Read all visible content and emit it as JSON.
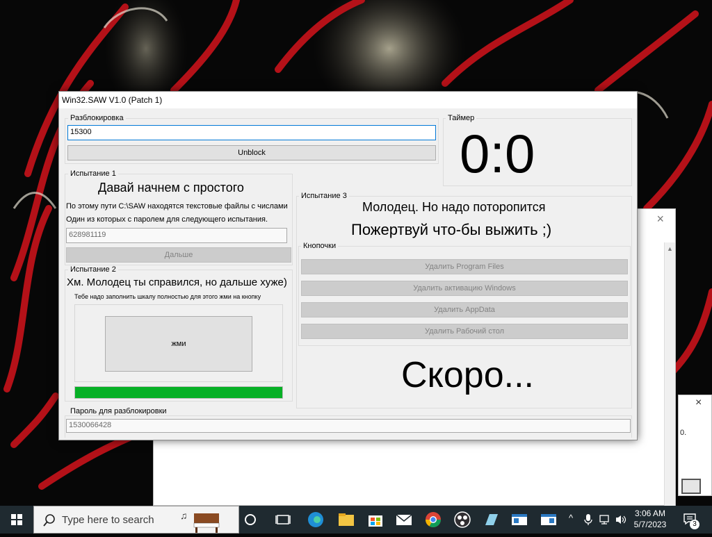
{
  "app": {
    "title": "Win32.SAW V1.0 (Patch 1)",
    "unlock": {
      "group_label": "Разблокировка",
      "input_value": "15300",
      "button_label": "Unblock"
    },
    "timer": {
      "group_label": "Таймер",
      "value": "0:0"
    },
    "test1": {
      "group_label": "Испытание 1",
      "heading": "Давай начнем с простого",
      "line1": "По этому пути C:\\SAW находятся текстовые файлы с числами",
      "line2": "Один из которых с паролем для следующего испытания.",
      "input_value": "628981119",
      "next_label": "Дальше"
    },
    "test2": {
      "group_label": "Испытание 2",
      "heading": "Хм. Молодец ты справился, но дальше хуже)",
      "instruction": "Тебе надо заполнить шкалу полностью для этого жми на кнопку",
      "press_label": "жми",
      "progress": 1.0,
      "progress_color": "#06b025"
    },
    "test3": {
      "group_label": "Испытание 3",
      "line1": "Молодец. Но надо поторопится",
      "line2": "Пожертвуй что-бы выжить ;)",
      "buttons_group_label": "Кнопочки",
      "buttons": [
        "Удалить Program Files",
        "Удалить активацию Windows",
        "Удалить AppData",
        "Удалить Рабочий стол"
      ],
      "soon": "Скоро..."
    },
    "password": {
      "group_label": "Пароль для разблокировки",
      "value": "1530066428"
    }
  },
  "background_window": {
    "close_icon": "×",
    "notif_text": "0."
  },
  "taskbar": {
    "search_placeholder": "Type here to search",
    "time": "3:06 AM",
    "date": "5/7/2023",
    "notification_count": "3",
    "icons": [
      "windows-start-icon",
      "search-icon",
      "cortana-icon",
      "task-view-icon",
      "edge-icon",
      "file-explorer-icon",
      "store-icon",
      "mail-icon",
      "chrome-icon",
      "obs-icon",
      "app-icon",
      "window-app-icon",
      "window-app-icon-2"
    ]
  }
}
